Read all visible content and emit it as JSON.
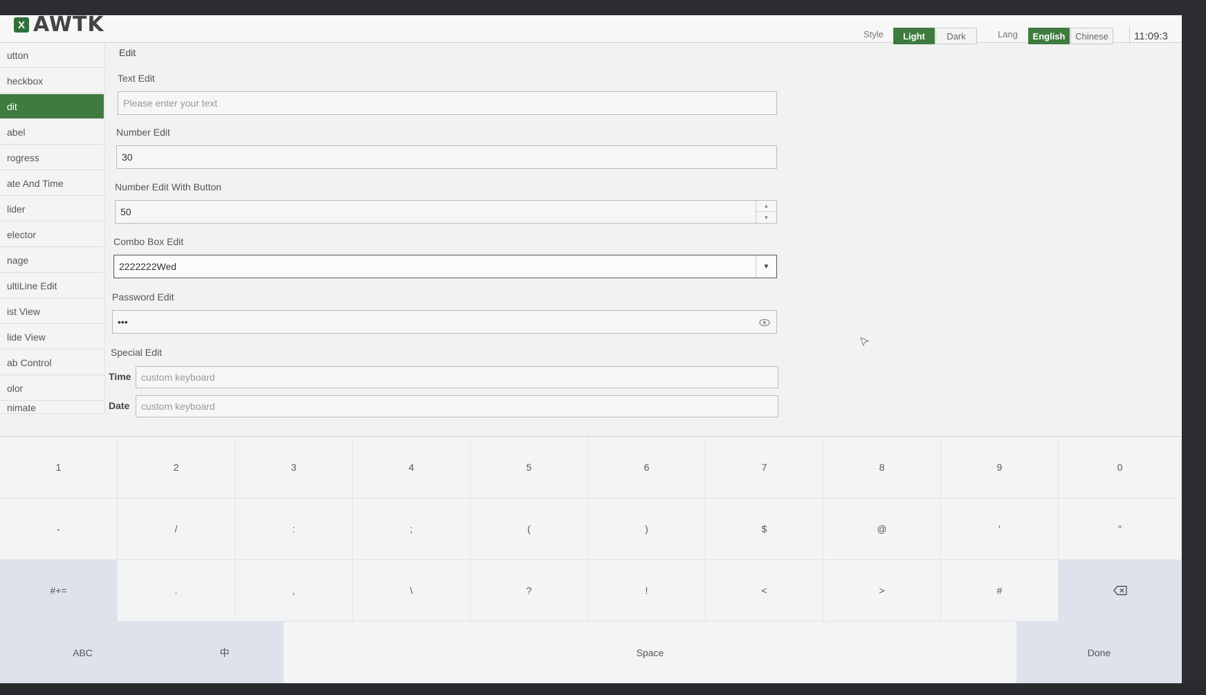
{
  "header": {
    "logo_badge": "X",
    "logo_text": "AWTK",
    "style_label": "Style",
    "style_options": [
      "Light",
      "Dark"
    ],
    "lang_label": "Lang",
    "lang_options": [
      "English",
      "Chinese"
    ],
    "clock": "11:09:3"
  },
  "sidebar": {
    "items": [
      {
        "label": "utton"
      },
      {
        "label": "heckbox"
      },
      {
        "label": "dit"
      },
      {
        "label": "abel"
      },
      {
        "label": "rogress"
      },
      {
        "label": "ate And Time"
      },
      {
        "label": "lider"
      },
      {
        "label": "elector"
      },
      {
        "label": "nage"
      },
      {
        "label": "ultiLine Edit"
      },
      {
        "label": "ist View"
      },
      {
        "label": "lide View"
      },
      {
        "label": "ab Control"
      },
      {
        "label": "olor"
      },
      {
        "label": "nimate"
      }
    ],
    "active_index": 2
  },
  "main": {
    "title": "Edit",
    "text_edit": {
      "label": "Text Edit",
      "placeholder": "Please enter your text"
    },
    "number_edit": {
      "label": "Number Edit",
      "value": "30"
    },
    "number_edit_button": {
      "label": "Number Edit With Button",
      "value": "50"
    },
    "combo_edit": {
      "label": "Combo Box Edit",
      "value": "2222222Wed"
    },
    "password_edit": {
      "label": "Password Edit",
      "value": "•••"
    },
    "special_edit": {
      "label": "Special Edit",
      "time_label": "Time",
      "time_placeholder": "custom keyboard",
      "date_label": "Date",
      "date_placeholder": "custom keyboard"
    }
  },
  "keyboard": {
    "row1": [
      "1",
      "2",
      "3",
      "4",
      "5",
      "6",
      "7",
      "8",
      "9",
      "0"
    ],
    "row2": [
      "-",
      "/",
      ":",
      ";",
      "(",
      ")",
      "$",
      "@",
      "'",
      "\""
    ],
    "row3": [
      "#+=",
      ".",
      ",",
      "\\",
      "?",
      "!",
      "<",
      ">",
      "#"
    ],
    "bottom": {
      "abc": "ABC",
      "zh": "中",
      "space": "Space",
      "done": "Done"
    }
  }
}
